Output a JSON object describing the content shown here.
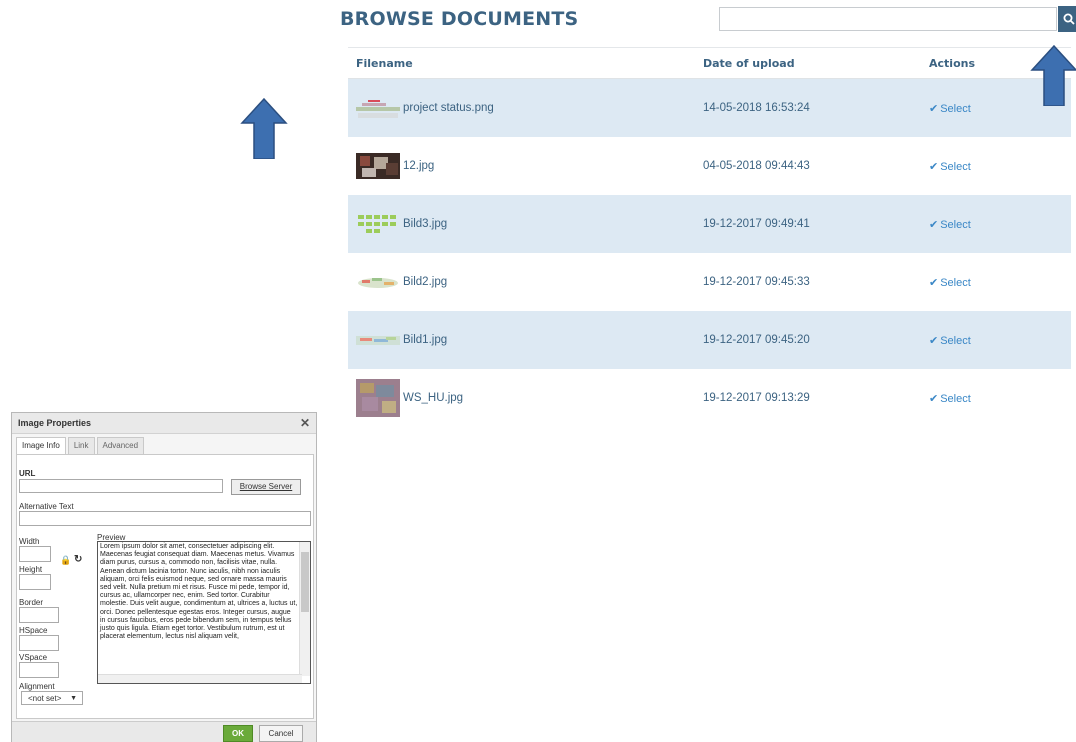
{
  "browse": {
    "title": "BROWSE DOCUMENTS",
    "search": {
      "value": "",
      "button_icon": "search-icon"
    },
    "columns": [
      "Filename",
      "Date of upload",
      "Actions"
    ],
    "rows": [
      {
        "name": "project status.png",
        "date": "14-05-2018 16:53:24",
        "action": "Select",
        "shaded": true
      },
      {
        "name": "12.jpg",
        "date": "04-05-2018 09:44:43",
        "action": "Select",
        "shaded": false
      },
      {
        "name": "Bild3.jpg",
        "date": "19-12-2017 09:49:41",
        "action": "Select",
        "shaded": true
      },
      {
        "name": "Bild2.jpg",
        "date": "19-12-2017 09:45:33",
        "action": "Select",
        "shaded": false
      },
      {
        "name": "Bild1.jpg",
        "date": "19-12-2017 09:45:20",
        "action": "Select",
        "shaded": true
      },
      {
        "name": "WS_HU.jpg",
        "date": "19-12-2017 09:13:29",
        "action": "Select",
        "shaded": false
      }
    ],
    "colors": {
      "accent": "#3c6382",
      "link": "#3a87c6",
      "row_shade": "#dde9f3"
    }
  },
  "dialog": {
    "title": "Image Properties",
    "tabs": [
      "Image Info",
      "Link",
      "Advanced"
    ],
    "url_label": "URL",
    "browse_server": "Browse Server",
    "alt_label": "Alternative Text",
    "width_label": "Width",
    "height_label": "Height",
    "border_label": "Border",
    "hspace_label": "HSpace",
    "vspace_label": "VSpace",
    "alignment_label": "Alignment",
    "alignment_value": "<not set>",
    "preview_label": "Preview",
    "preview_text": "Lorem ipsum dolor sit amet, consectetuer adipiscing elit. Maecenas feugiat consequat diam. Maecenas metus. Vivamus diam purus, cursus a, commodo non, facilisis vitae, nulla. Aenean dictum lacinia tortor. Nunc iaculis, nibh non iaculis aliquam, orci felis euismod neque, sed ornare massa mauris sed velit. Nulla pretium mi et risus. Fusce mi pede, tempor id, cursus ac, ullamcorper nec, enim. Sed tortor. Curabitur molestie. Duis velit augue, condimentum at, ultrices a, luctus ut, orci. Donec pellentesque egestas eros. Integer cursus, augue in cursus faucibus, eros pede bibendum sem, in tempus tellus justo quis ligula. Etiam eget tortor. Vestibulum rutrum, est ut placerat elementum, lectus nisl aliquam velit,",
    "ok": "OK",
    "cancel": "Cancel"
  },
  "arrow_color": "#3d6fb0"
}
